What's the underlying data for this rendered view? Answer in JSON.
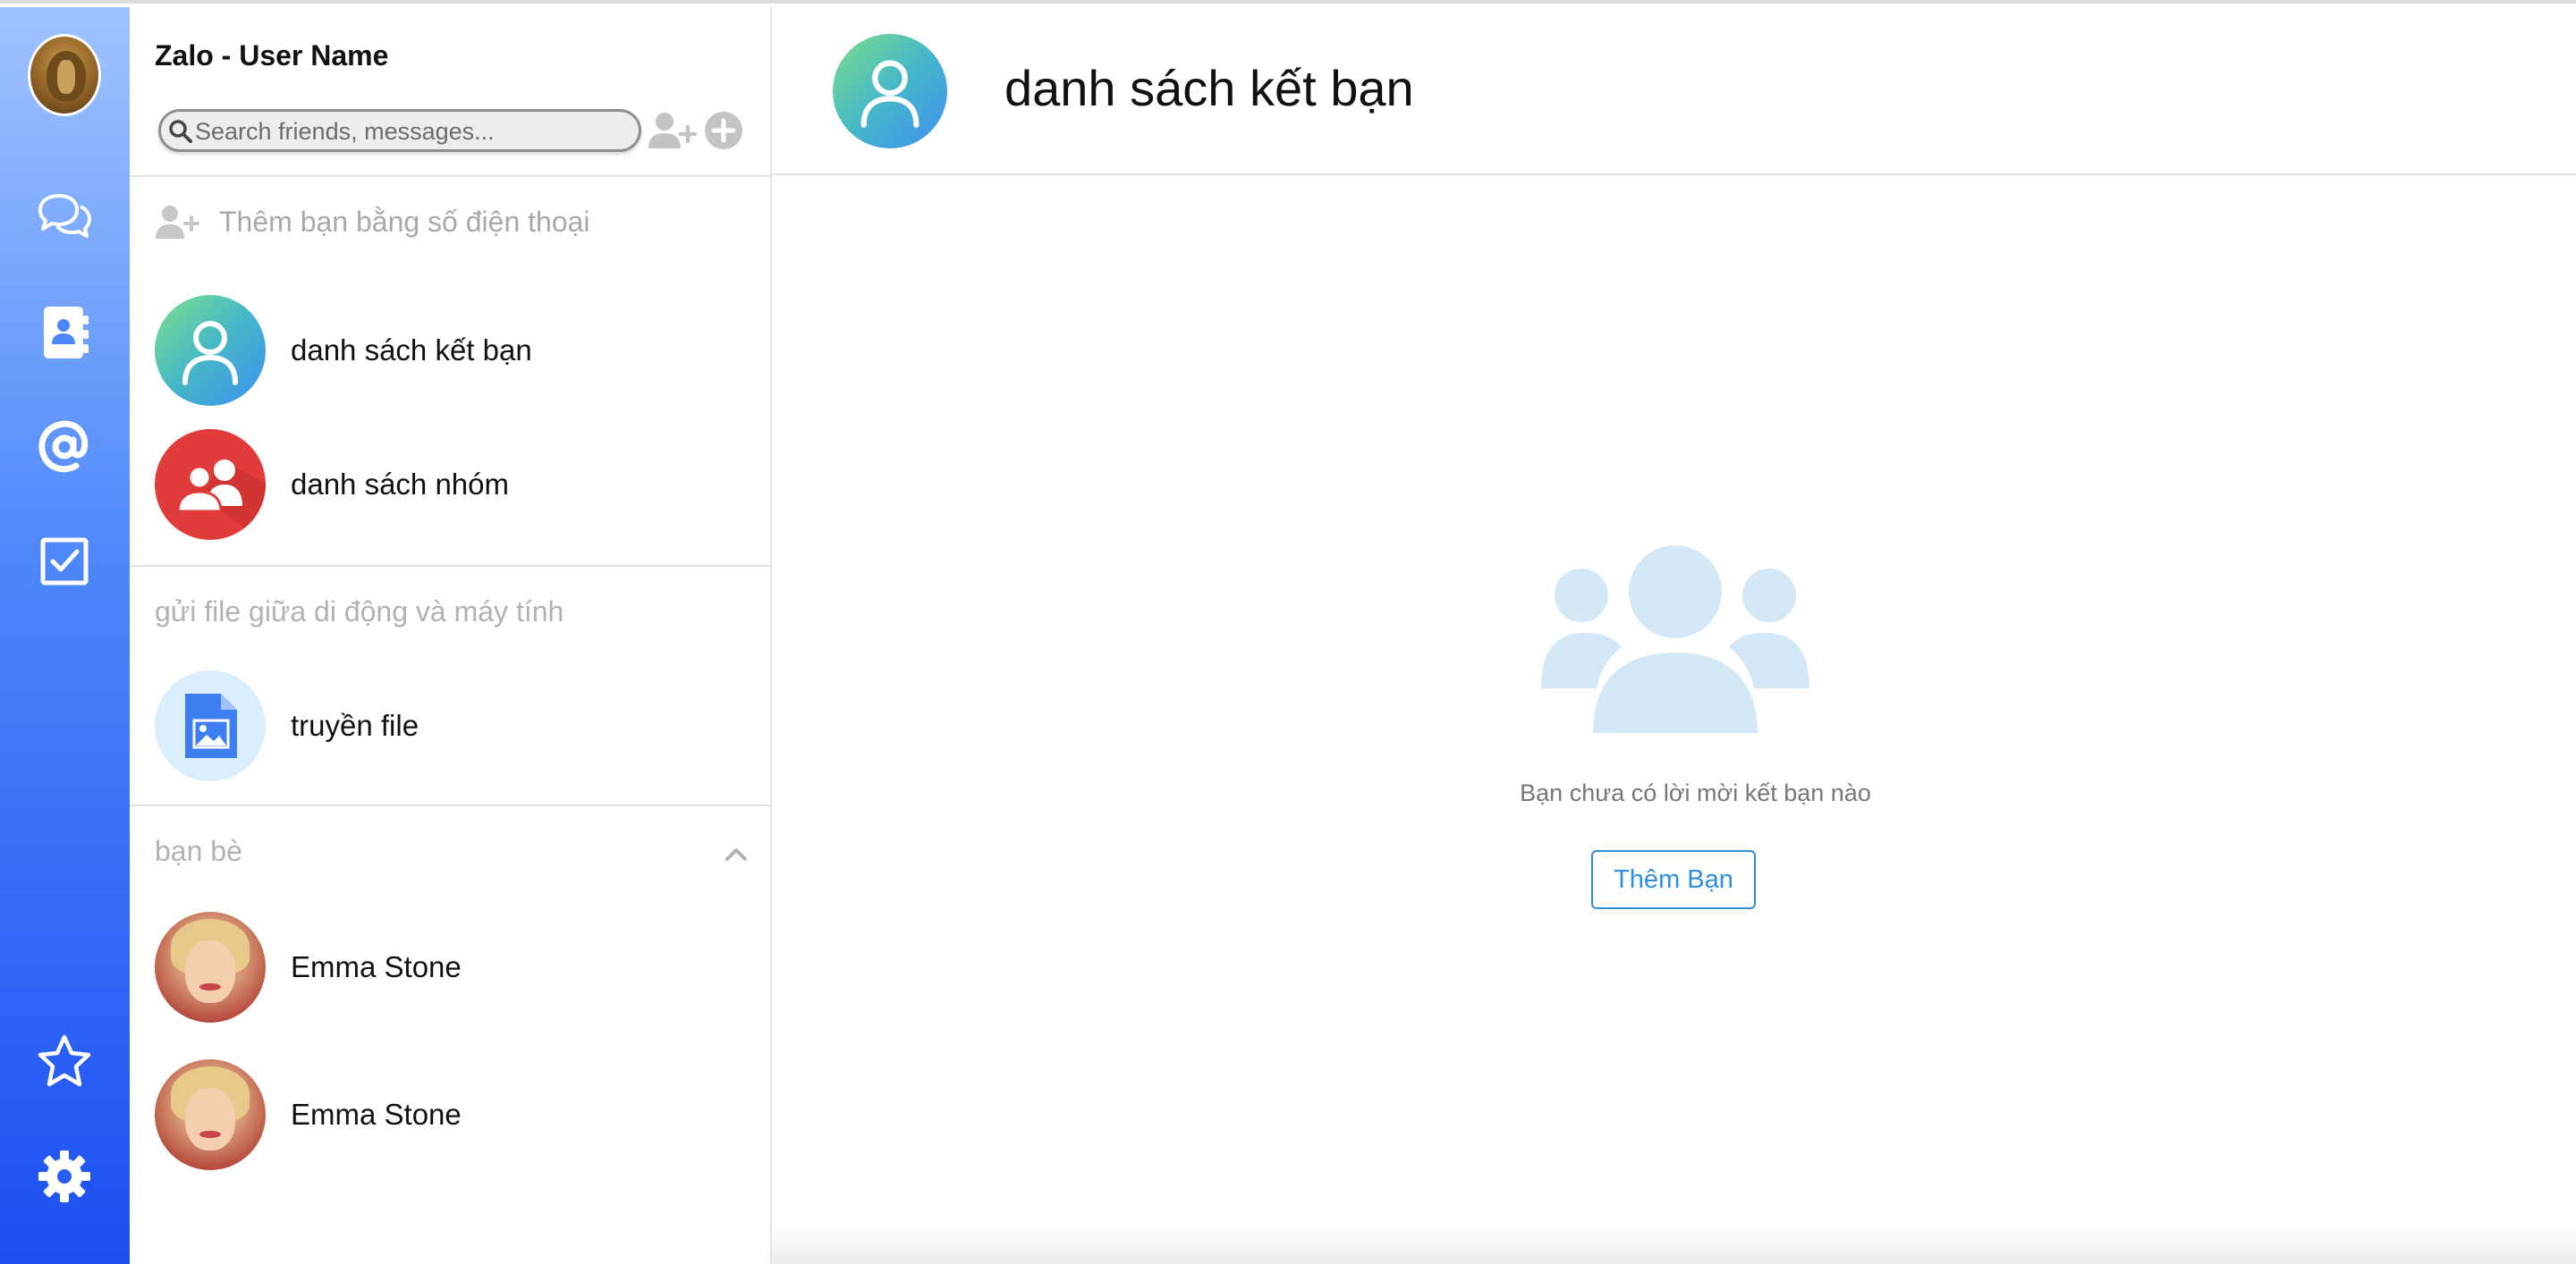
{
  "panel": {
    "title": "Zalo - User Name",
    "search_placeholder": "Search friends, messages..."
  },
  "contacts": {
    "add_by_phone": "Thêm bạn bằng số điện thoại",
    "friend_list": "danh sách kết bạn",
    "group_list": "danh sách nhóm",
    "file_section": "gửi file giữa di động và máy tính",
    "file_transfer": "truyền file",
    "friends_section": "bạn bè",
    "friends": [
      {
        "name": "Emma Stone"
      },
      {
        "name": "Emma Stone"
      }
    ]
  },
  "main": {
    "title": "danh sách kết bạn",
    "empty_text": "Bạn chưa có lời mời kết bạn nào",
    "add_button": "Thêm Bạn"
  },
  "nav": {
    "icons": [
      "chat-icon",
      "contacts-icon",
      "mention-icon",
      "todo-icon",
      "star-icon",
      "settings-icon"
    ]
  },
  "colors": {
    "nav_gradient_top": "#9fc3ff",
    "nav_gradient_bottom": "#1c4ff2",
    "friend_list_gradient": [
      "#7ee08a",
      "#3d8ff0"
    ],
    "group_red": "#e23b3b",
    "empty_icon": "#d5e8f6",
    "button_blue": "#2f8ee0",
    "muted_text": "#a9a9a9"
  }
}
